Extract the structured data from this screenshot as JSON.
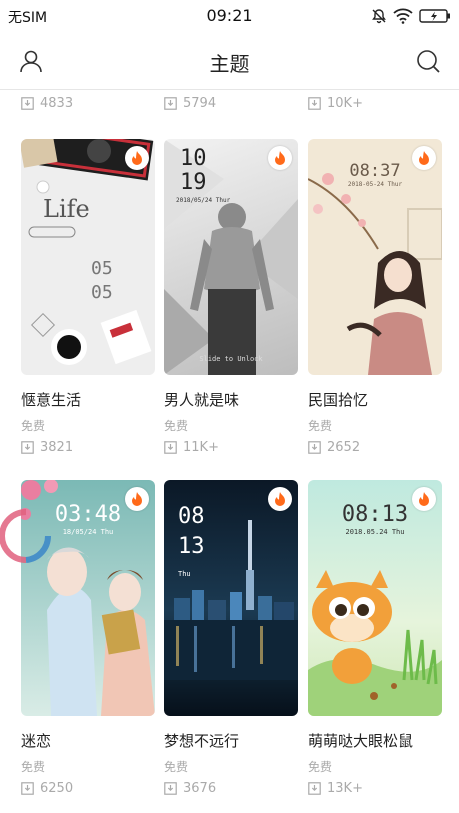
{
  "status_bar": {
    "carrier": "无SIM",
    "time": "09:21"
  },
  "header": {
    "title": "主题"
  },
  "top_row": [
    "4833",
    "5794",
    "10K+"
  ],
  "themes": [
    {
      "title": "惬意生活",
      "price": "免费",
      "downloads": "3821",
      "preview_text": "Life",
      "preview_time": "05 05"
    },
    {
      "title": "男人就是味",
      "price": "免费",
      "downloads": "11K+",
      "preview_time": "10 19",
      "preview_date": "2018/05/24 Thur",
      "preview_hint": "Slide to Unlock"
    },
    {
      "title": "民国拾忆",
      "price": "免费",
      "downloads": "2652",
      "preview_time": "08:37",
      "preview_date": "2018-05-24 Thur"
    },
    {
      "title": "迷恋",
      "price": "免费",
      "downloads": "6250",
      "preview_time": "03:48",
      "preview_date": "18/05/24 Thu"
    },
    {
      "title": "梦想不远行",
      "price": "免费",
      "downloads": "3676",
      "preview_time": "08 13",
      "preview_date": "Thu"
    },
    {
      "title": "萌萌哒大眼松鼠",
      "price": "免费",
      "downloads": "13K+",
      "preview_time": "08:13",
      "preview_date": "2018.05.24 Thu"
    }
  ],
  "colors": {
    "badge_orange": "#ff6a1a",
    "divider": "#e6e6e6",
    "meta_gray": "#aaaaaa"
  }
}
